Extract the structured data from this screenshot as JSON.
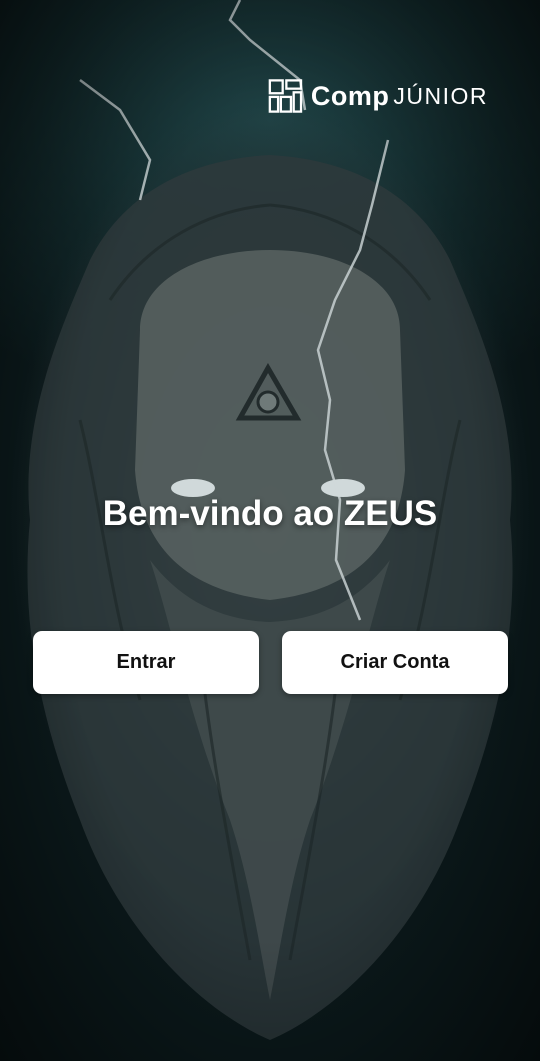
{
  "logo": {
    "word": "Comp",
    "sub": "JÚNIOR"
  },
  "welcome": {
    "title": "Bem-vindo ao ZEUS"
  },
  "actions": {
    "login_label": "Entrar",
    "signup_label": "Criar Conta"
  },
  "theme": {
    "background": "#0c1a1c",
    "button_bg": "#ffffff",
    "button_text": "#111111",
    "title_color": "#ffffff"
  },
  "icons": {
    "logo_mark": "grid-blocks-icon",
    "background_art": "zeus-face-illustration"
  }
}
